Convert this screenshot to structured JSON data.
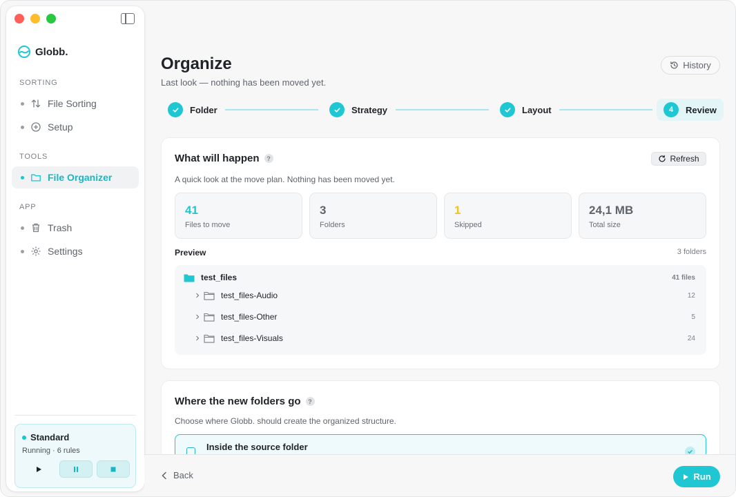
{
  "app": {
    "name": "Globb."
  },
  "colors": {
    "accent": "#1fc7d3",
    "accent_text": "#17b8c4",
    "warning": "#f6c21a"
  },
  "sidebar": {
    "sections": [
      {
        "label": "SORTING",
        "items": [
          {
            "label": "File Sorting",
            "icon": "sort-arrows-icon"
          },
          {
            "label": "Setup",
            "icon": "plus-circle-icon"
          }
        ]
      },
      {
        "label": "TOOLS",
        "items": [
          {
            "label": "File Organizer",
            "icon": "folder-icon",
            "active": true
          }
        ]
      },
      {
        "label": "APP",
        "items": [
          {
            "label": "Trash",
            "icon": "trash-icon"
          },
          {
            "label": "Settings",
            "icon": "gear-icon"
          }
        ]
      }
    ],
    "status": {
      "title": "Standard",
      "subtitle": "Running · 6 rules"
    }
  },
  "header": {
    "title": "Organize",
    "subtitle": "Last look — nothing has been moved yet.",
    "history_label": "History"
  },
  "steps": [
    {
      "label": "Folder",
      "state": "done"
    },
    {
      "label": "Strategy",
      "state": "done"
    },
    {
      "label": "Layout",
      "state": "done"
    },
    {
      "label": "Review",
      "state": "current",
      "number": "4"
    }
  ],
  "summary_card": {
    "title": "What will happen",
    "help": "?",
    "description": "A quick look at the move plan. Nothing has been moved yet.",
    "refresh_label": "Refresh",
    "stats": [
      {
        "value": "41",
        "label": "Files to move",
        "color": "#1fc7d3"
      },
      {
        "value": "3",
        "label": "Folders",
        "color": "#5f646b"
      },
      {
        "value": "1",
        "label": "Skipped",
        "color": "#f6c21a"
      },
      {
        "value": "24,1 MB",
        "label": "Total size",
        "color": "#5f646b"
      }
    ],
    "preview_title": "Preview",
    "preview_count": "3 folders",
    "tree": {
      "root": {
        "name": "test_files",
        "count": "41 files"
      },
      "children": [
        {
          "name": "test_files-Audio",
          "count": "12"
        },
        {
          "name": "test_files-Other",
          "count": "5"
        },
        {
          "name": "test_files-Visuals",
          "count": "24"
        }
      ]
    }
  },
  "destination_card": {
    "title": "Where the new folders go",
    "help": "?",
    "description": "Choose where Globb. should create the organized structure.",
    "option_label": "Inside the source folder"
  },
  "footer": {
    "back_label": "Back",
    "run_label": "Run"
  }
}
